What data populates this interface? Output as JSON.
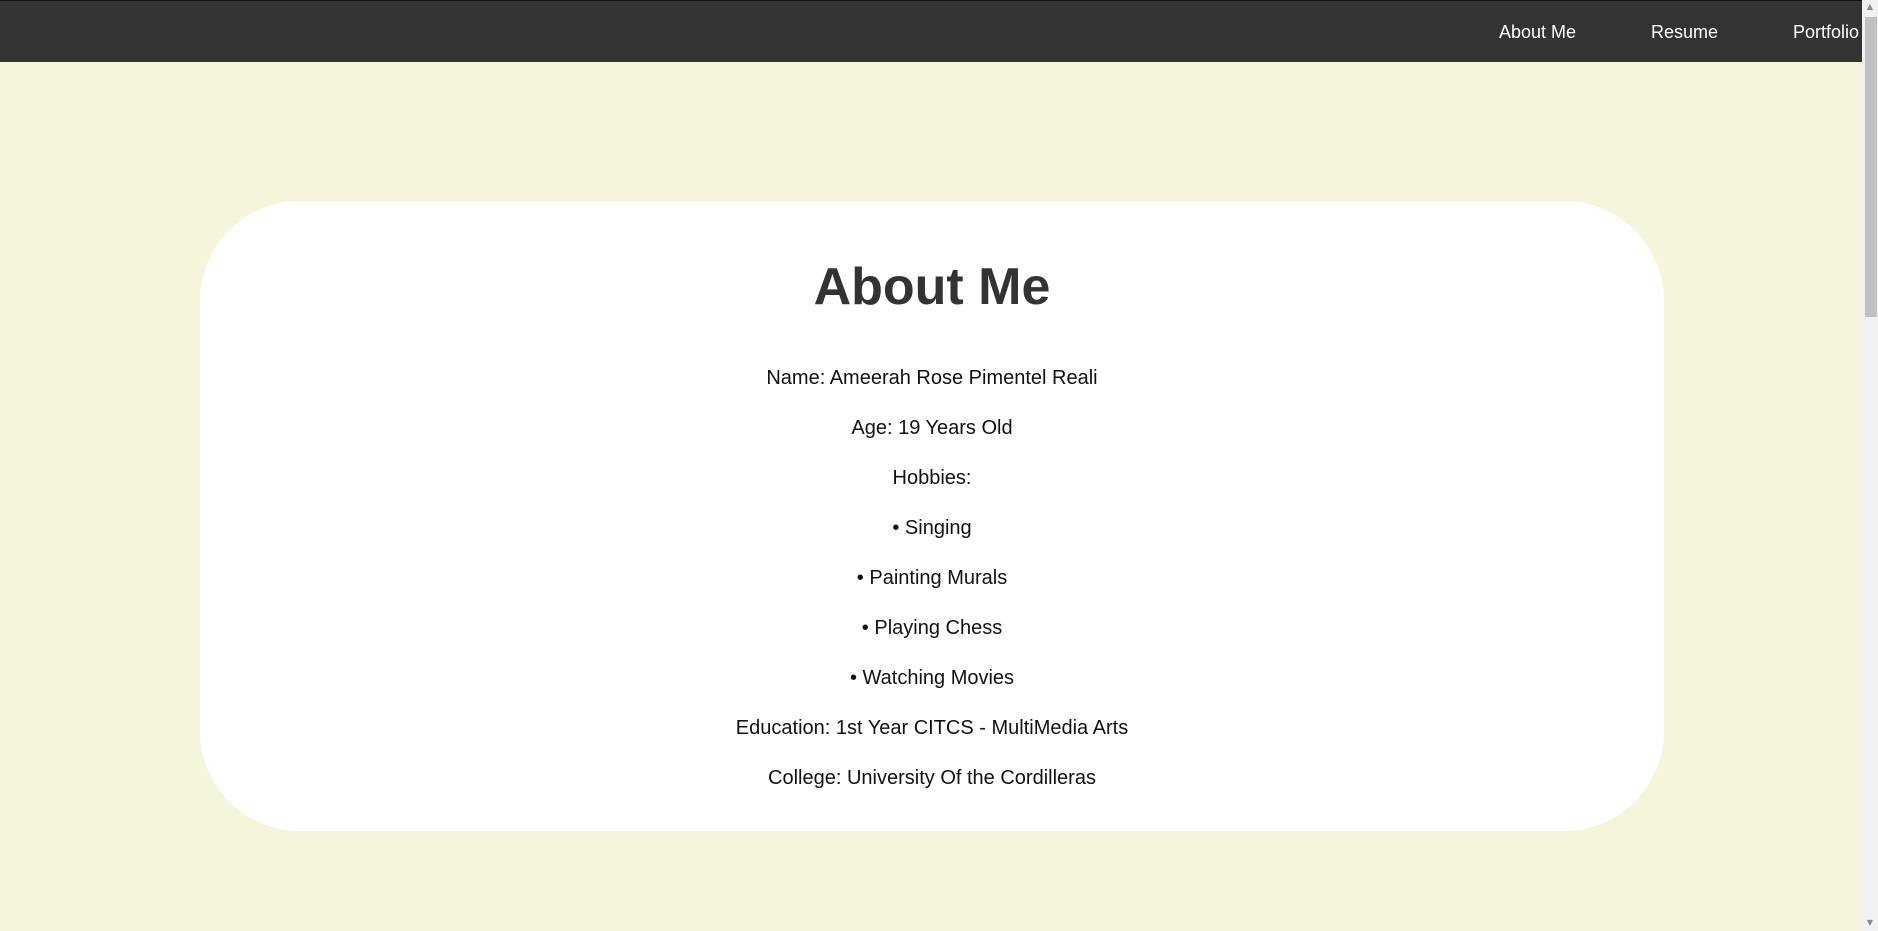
{
  "nav": {
    "about_label": "About Me",
    "resume_label": "Resume",
    "portfolio_label": "Portfolio"
  },
  "about": {
    "title": "About Me",
    "lines": [
      "Name: Ameerah Rose Pimentel Reali",
      "Age: 19 Years Old",
      "Hobbies:",
      "• Singing",
      "• Painting Murals",
      "• Playing Chess",
      "• Watching Movies",
      "Education: 1st Year CITCS - MultiMedia Arts",
      "College: University Of the Cordilleras"
    ]
  },
  "colors": {
    "page_background": "#f5f5dc",
    "navbar_background": "#333333",
    "card_background": "#ffffff",
    "title_text": "#333333"
  },
  "icons": {
    "scroll_up": "chevron-up-icon",
    "scroll_down": "chevron-down-icon"
  }
}
